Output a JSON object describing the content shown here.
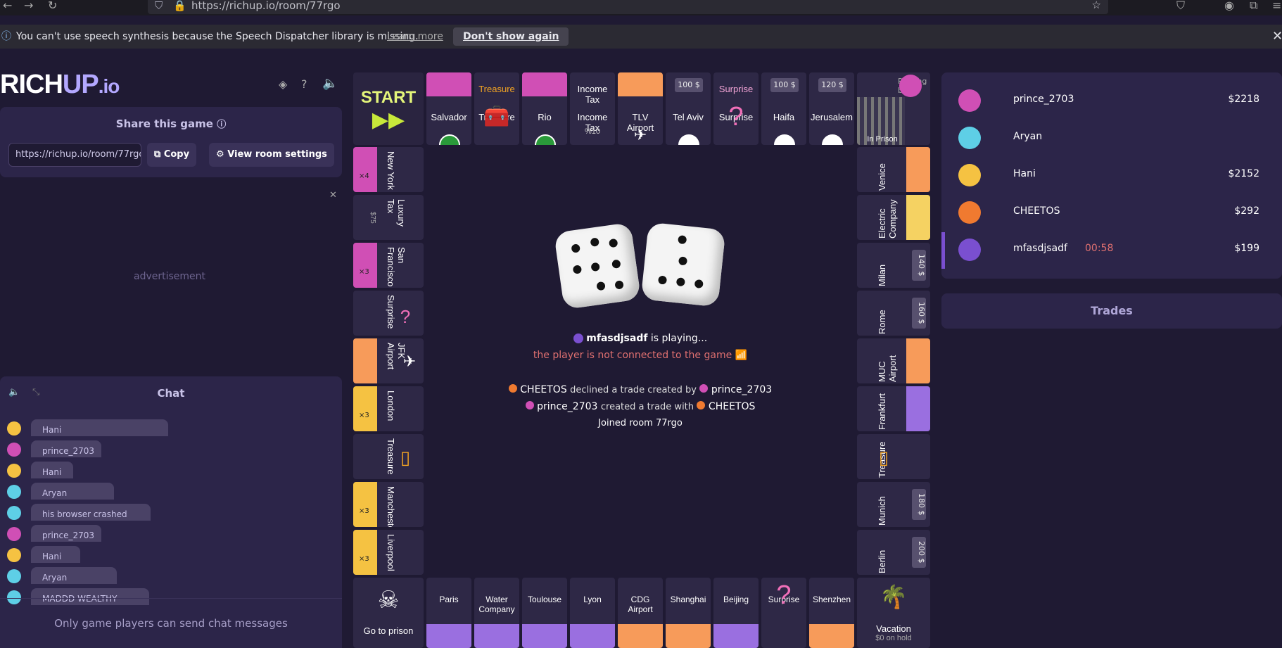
{
  "browser": {
    "url": "https://richup.io/room/77rgo"
  },
  "notification": {
    "text": "You can't use speech synthesis because the Speech Dispatcher library is missing.",
    "learn_more": "Learn more",
    "dont_show": "Don't show again"
  },
  "logo": {
    "rich": "RICH",
    "up": "UP",
    "io": ".io"
  },
  "share": {
    "title": "Share this game",
    "url": "https://richup.io/room/77rgo",
    "copy": "Copy",
    "room_settings": "View room settings"
  },
  "ad": {
    "label": "advertisement"
  },
  "chat": {
    "title": "Chat",
    "footer": "Only game players can send chat messages",
    "messages": [
      {
        "user": "Hani",
        "color": "#f5c242"
      },
      {
        "user": "prince_2703",
        "color": "#d04fb5"
      },
      {
        "user": "Hani",
        "color": "#f5c242"
      },
      {
        "user": "Aryan",
        "color": "#5ecfe6"
      },
      {
        "user": "his browser crashed",
        "color": "#5ecfe6"
      },
      {
        "user": "prince_2703",
        "color": "#d04fb5"
      },
      {
        "user": "Hani",
        "color": "#f5c242"
      },
      {
        "user": "Aryan",
        "color": "#5ecfe6"
      },
      {
        "user": "MADDD WEALTHY",
        "color": "#5ecfe6"
      }
    ]
  },
  "board": {
    "start": "START",
    "top": [
      "Salvador",
      "Treasure",
      "Rio",
      "Income Tax",
      "TLV Airport",
      "Tel Aviv",
      "Surprise",
      "Haifa",
      "Jerusalem",
      "In Prison"
    ],
    "top_prices": {
      "tel_aviv": "100 $",
      "haifa": "100 $",
      "jerusalem": "120 $"
    },
    "income_tax": "%10",
    "left": [
      "New York",
      "Luxury Tax",
      "San Francisco",
      "Surprise",
      "JFK Airport",
      "London",
      "Treasure",
      "Manchester",
      "Liverpool"
    ],
    "luxury_price": "$75",
    "houses": {
      "ny": "×4",
      "sf": "×3",
      "london": "×3",
      "manchester": "×3",
      "liverpool": "×3"
    },
    "right": [
      "Venice",
      "Electric Company",
      "Milan",
      "Rome",
      "MUC Airport",
      "Frankfurt",
      "Treasure",
      "Munich",
      "Berlin"
    ],
    "right_prices": {
      "milan": "140 $",
      "rome": "160 $",
      "munich": "180 $",
      "berlin": "200 $"
    },
    "bottom": [
      "Paris",
      "Water Company",
      "Toulouse",
      "Lyon",
      "CDG Airport",
      "Shanghai",
      "Beijing",
      "Surprise",
      "Shenzhen"
    ],
    "go_to_prison": "Go to prison",
    "vacation": "Vacation",
    "vacation_hold": "$0 on hold",
    "passing_by": "Passing by",
    "status": {
      "player": "mfasdjsadf",
      "playing": "is playing...",
      "disconnected": "the player is not connected to the game"
    },
    "log": [
      {
        "a": "CHEETOS",
        "mid": "declined a trade created by",
        "b": "prince_2703"
      },
      {
        "a": "prince_2703",
        "mid": "created a trade with",
        "b": "CHEETOS"
      },
      {
        "text": "Joined room 77rgo"
      }
    ]
  },
  "players": [
    {
      "name": "prince_2703",
      "money": "$2218",
      "color": "#d04fb5"
    },
    {
      "name": "Aryan",
      "money": "",
      "color": "#5ecfe6"
    },
    {
      "name": "Hani",
      "money": "$2152",
      "color": "#f5c242"
    },
    {
      "name": "CHEETOS",
      "money": "$292",
      "color": "#f07a30"
    },
    {
      "name": "mfasdjsadf",
      "money": "$199",
      "timer": "00:58",
      "color": "#7a4fd0"
    }
  ],
  "trades": {
    "label": "Trades"
  }
}
